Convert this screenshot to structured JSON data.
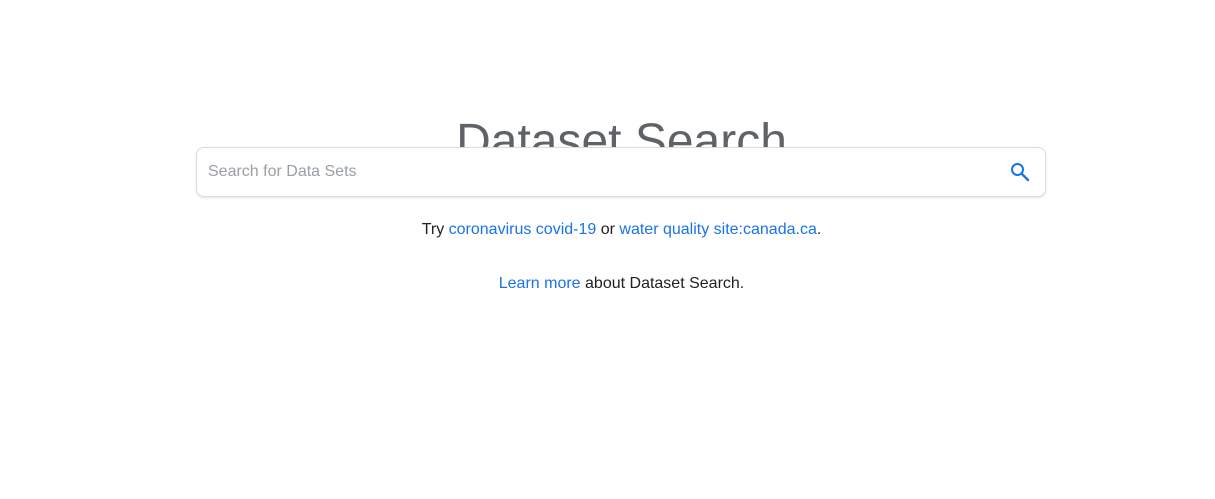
{
  "header": {
    "title": "Dataset Search"
  },
  "search": {
    "placeholder": "Search for Data Sets",
    "value": "",
    "icon": "search-icon"
  },
  "suggestions": {
    "prefix": "Try ",
    "link1": "coronavirus covid-19",
    "separator": " or ",
    "link2": "water quality site:canada.ca",
    "suffix": "."
  },
  "learn_more": {
    "link": "Learn more",
    "text": " about Dataset Search."
  },
  "colors": {
    "title": "#5f6368",
    "link": "#1a73e8",
    "border": "#dadce0",
    "icon": "#1a73e8"
  }
}
